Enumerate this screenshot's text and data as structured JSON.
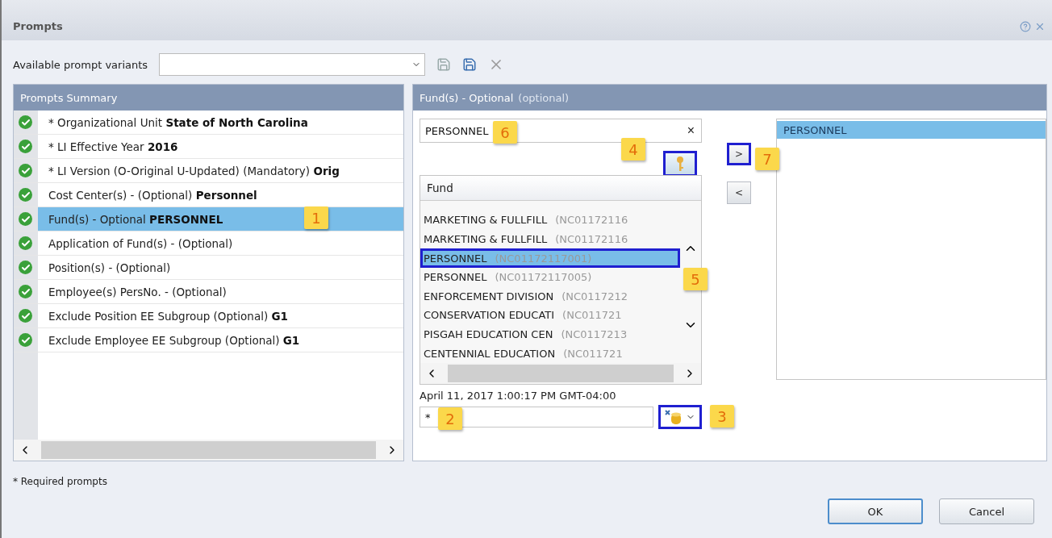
{
  "dialog": {
    "title": "Prompts"
  },
  "variants": {
    "label": "Available prompt variants"
  },
  "prompts_summary": {
    "title": "Prompts Summary",
    "items": [
      {
        "text": "* Organizational Unit **State of North Carolina**",
        "selected": false
      },
      {
        "text": "* LI Effective Year **2016**",
        "selected": false
      },
      {
        "text": "* LI Version (O-Original U-Updated) (Mandatory) **Orig**",
        "selected": false
      },
      {
        "text": "Cost Center(s) - (Optional) **Personnel**",
        "selected": false
      },
      {
        "text": "Fund(s) - Optional **PERSONNEL**",
        "selected": true,
        "callout": "1"
      },
      {
        "text": "Application of Fund(s) - (Optional)",
        "selected": false
      },
      {
        "text": "Position(s) - (Optional)",
        "selected": false
      },
      {
        "text": "Employee(s) PersNo. - (Optional)",
        "selected": false
      },
      {
        "text": "Exclude Position EE Subgroup (Optional) **G1**",
        "selected": false
      },
      {
        "text": "Exclude Employee EE Subgroup (Optional) **G1**",
        "selected": false
      }
    ]
  },
  "detail": {
    "title": "Fund(s) - Optional",
    "hint": "(optional)",
    "search": {
      "value": "PERSONNEL",
      "clear": "×",
      "callout": "6"
    },
    "search_button": {
      "callout": "4",
      "highlighted": true
    },
    "list": {
      "column": "Fund",
      "callout": "5",
      "rows": [
        {
          "name": "MARKETING & FULLFILL",
          "code": "(NC01172116",
          "selected": false,
          "highlighted": false
        },
        {
          "name": "MARKETING & FULLFILL",
          "code": "(NC01172116",
          "selected": false,
          "highlighted": false
        },
        {
          "name": "PERSONNEL",
          "code": "(NC01172117001)",
          "selected": true,
          "highlighted": true
        },
        {
          "name": "PERSONNEL",
          "code": "(NC01172117005)",
          "selected": false,
          "highlighted": false
        },
        {
          "name": "ENFORCEMENT DIVISION",
          "code": "(NC0117212",
          "selected": false,
          "highlighted": false
        },
        {
          "name": "CONSERVATION EDUCATI",
          "code": "(NC011721",
          "selected": false,
          "highlighted": false
        },
        {
          "name": "PISGAH EDUCATION CEN",
          "code": "(NC0117213",
          "selected": false,
          "highlighted": false
        },
        {
          "name": "CENTENNIAL EDUCATION",
          "code": "(NC011721",
          "selected": false,
          "highlighted": false
        }
      ]
    },
    "timestamp": "April 11, 2017 1:00:17 PM GMT-04:00",
    "value_field": {
      "value": "*",
      "callout": "2"
    },
    "source_button": {
      "callout": "3",
      "highlighted": true
    },
    "add_button": {
      "label": ">",
      "highlighted": true,
      "callout": "7"
    },
    "remove_button": {
      "label": "<"
    },
    "selected_values": [
      {
        "text": "PERSONNEL",
        "selected": true
      }
    ]
  },
  "footnote": "* Required prompts",
  "buttons": [
    {
      "label": "OK",
      "default": true
    },
    {
      "label": "Cancel",
      "default": false
    }
  ]
}
